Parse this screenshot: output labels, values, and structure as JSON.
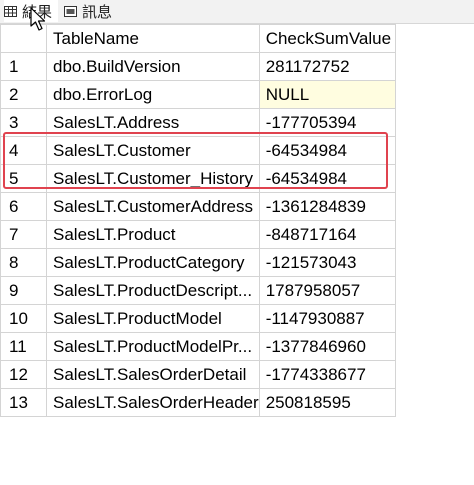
{
  "tabs": [
    {
      "label": "結果",
      "icon": "grid-icon",
      "active": true
    },
    {
      "label": "訊息",
      "icon": "messages-icon",
      "active": false
    }
  ],
  "table": {
    "columns": [
      "",
      "TableName",
      "CheckSumValue"
    ],
    "rows": [
      {
        "num": "1",
        "name": "dbo.BuildVersion",
        "value": "281172752"
      },
      {
        "num": "2",
        "name": "dbo.ErrorLog",
        "value": "NULL"
      },
      {
        "num": "3",
        "name": "SalesLT.Address",
        "value": "-177705394"
      },
      {
        "num": "4",
        "name": "SalesLT.Customer",
        "value": "-64534984"
      },
      {
        "num": "5",
        "name": "SalesLT.Customer_History",
        "value": "-64534984"
      },
      {
        "num": "6",
        "name": "SalesLT.CustomerAddress",
        "value": "-1361284839"
      },
      {
        "num": "7",
        "name": "SalesLT.Product",
        "value": "-848717164"
      },
      {
        "num": "8",
        "name": "SalesLT.ProductCategory",
        "value": "-121573043"
      },
      {
        "num": "9",
        "name": "SalesLT.ProductDescript...",
        "value": "1787958057"
      },
      {
        "num": "10",
        "name": "SalesLT.ProductModel",
        "value": "-1147930887"
      },
      {
        "num": "11",
        "name": "SalesLT.ProductModelPr...",
        "value": "-1377846960"
      },
      {
        "num": "12",
        "name": "SalesLT.SalesOrderDetail",
        "value": "-1774338677"
      },
      {
        "num": "13",
        "name": "SalesLT.SalesOrderHeader",
        "value": "250818595"
      }
    ]
  },
  "colors": {
    "highlight_border": "#e0434f",
    "null_cell_bg": "#fffde0",
    "grid_line": "#d4d4d4"
  }
}
